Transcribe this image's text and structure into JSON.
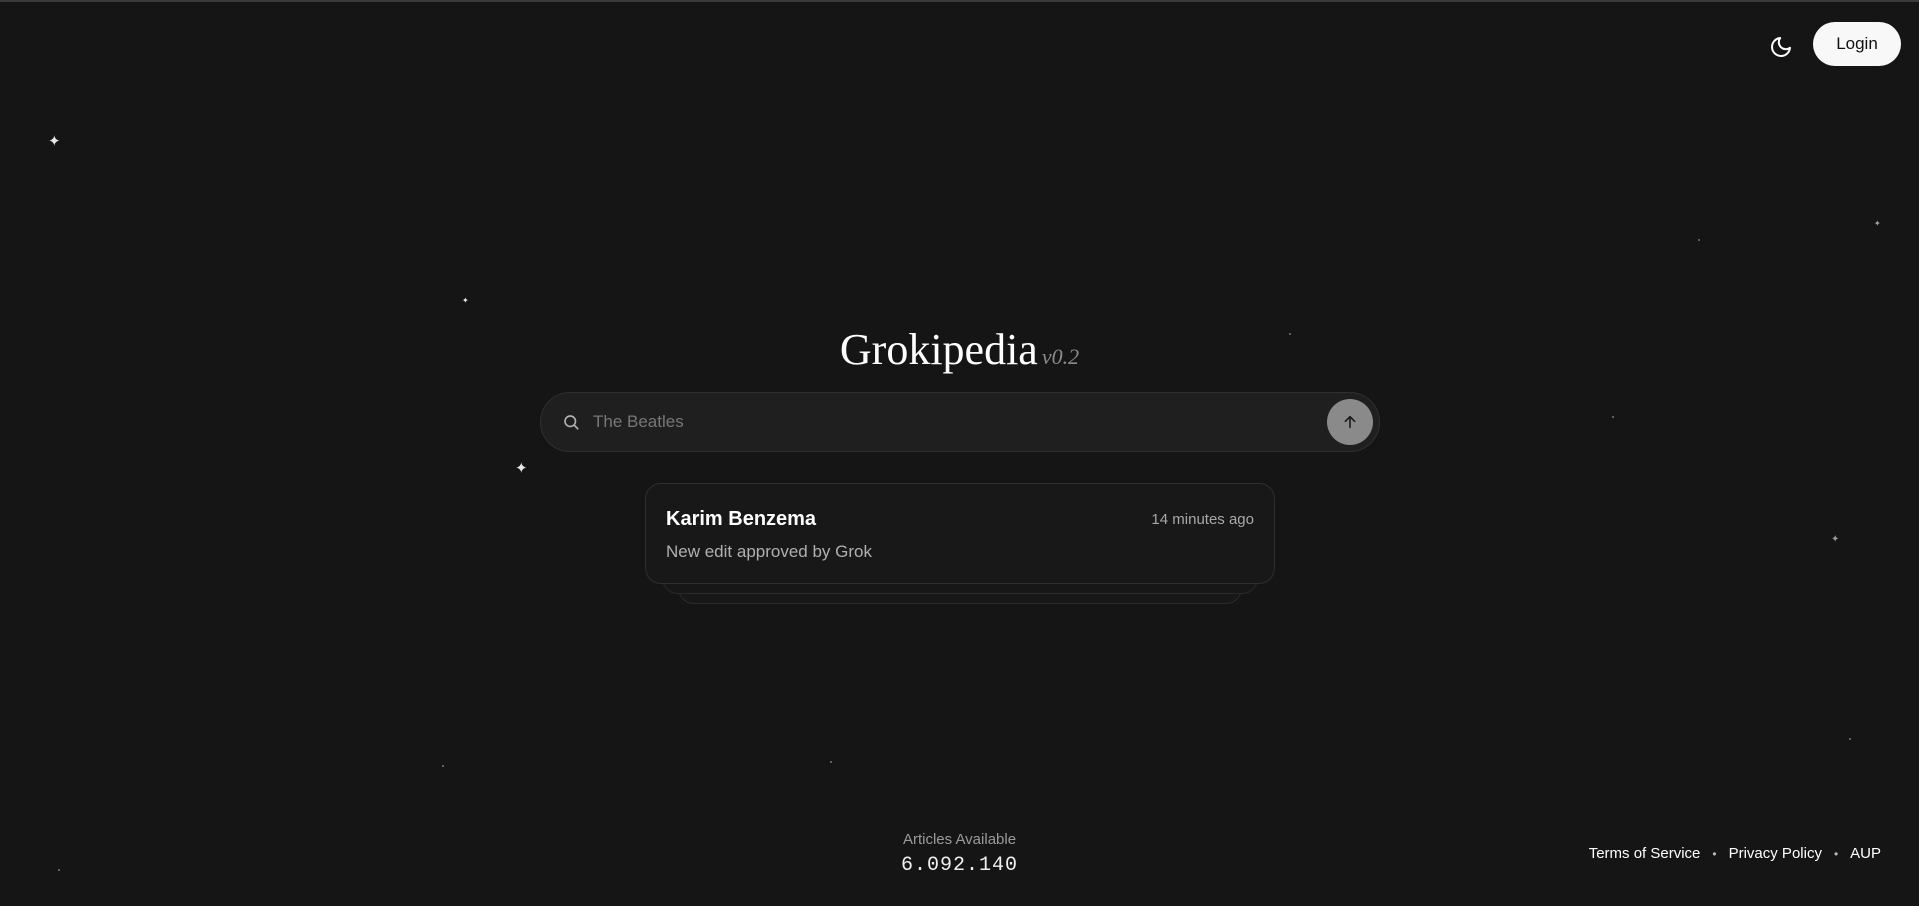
{
  "header": {
    "theme_toggle_icon": "moon-icon",
    "login_label": "Login"
  },
  "brand": {
    "name": "Grokipedia",
    "version": "v0.2"
  },
  "search": {
    "icon": "search-icon",
    "placeholder": "The Beatles",
    "value": "",
    "submit_icon": "arrow-up-icon"
  },
  "activity": {
    "title": "Karim Benzema",
    "time": "14 minutes ago",
    "description": "New edit approved by Grok"
  },
  "stats": {
    "label": "Articles Available",
    "value": "6.092.140"
  },
  "footer": {
    "links": [
      "Terms of Service",
      "Privacy Policy",
      "AUP"
    ],
    "separator": "•"
  },
  "colors": {
    "background": "#151515",
    "accent_button": "#f8f8f8",
    "submit_button": "#8a8a8a"
  }
}
